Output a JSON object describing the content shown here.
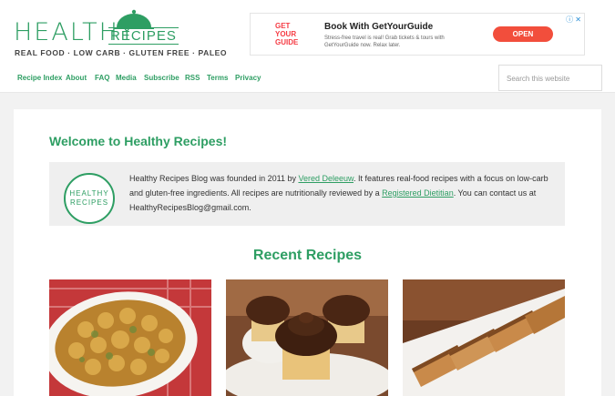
{
  "logo": {
    "healthy": "HEALTHY",
    "recipes": "RECIPES",
    "tagline": "REAL FOOD · LOW CARB · GLUTEN FREE · PALEO"
  },
  "ad": {
    "brand": "GET YOUR GUIDE",
    "title": "Book With GetYourGuide",
    "text": "Stress-free travel is real! Grab tickets & tours with GetYourGuide now. Relax later.",
    "cta": "OPEN",
    "icons": "ⓘ ✕"
  },
  "nav": {
    "items": [
      "Recipe Index",
      "About",
      "FAQ",
      "Media",
      "Subscribe",
      "RSS",
      "Terms",
      "Privacy"
    ]
  },
  "search": {
    "placeholder": "Search this website"
  },
  "welcome": {
    "title": "Welcome to Healthy Recipes!"
  },
  "about": {
    "badge_line1": "HEALTHY",
    "badge_line2": "RECIPES",
    "text_before_author": "Healthy Recipes Blog was founded in 2011 by ",
    "author_link": "Vered Deleeuw",
    "text_middle": ". It features real-food recipes with a focus on low-carb and gluten-free ingredients. All recipes are nutritionally reviewed by a ",
    "dietitian_link": "Registered Dietitian",
    "text_after": ". You can contact us at HealthyRecipesBlog@gmail.com."
  },
  "recent": {
    "title": "Recent Recipes"
  },
  "colors": {
    "brand_green": "#2e9e63",
    "ad_button": "#f24e3c"
  },
  "cards": [
    {
      "image": "roasted-zucchini-casserole"
    },
    {
      "image": "chocolate-frosted-cupcakes"
    },
    {
      "image": "sliced-banana-bread"
    }
  ]
}
